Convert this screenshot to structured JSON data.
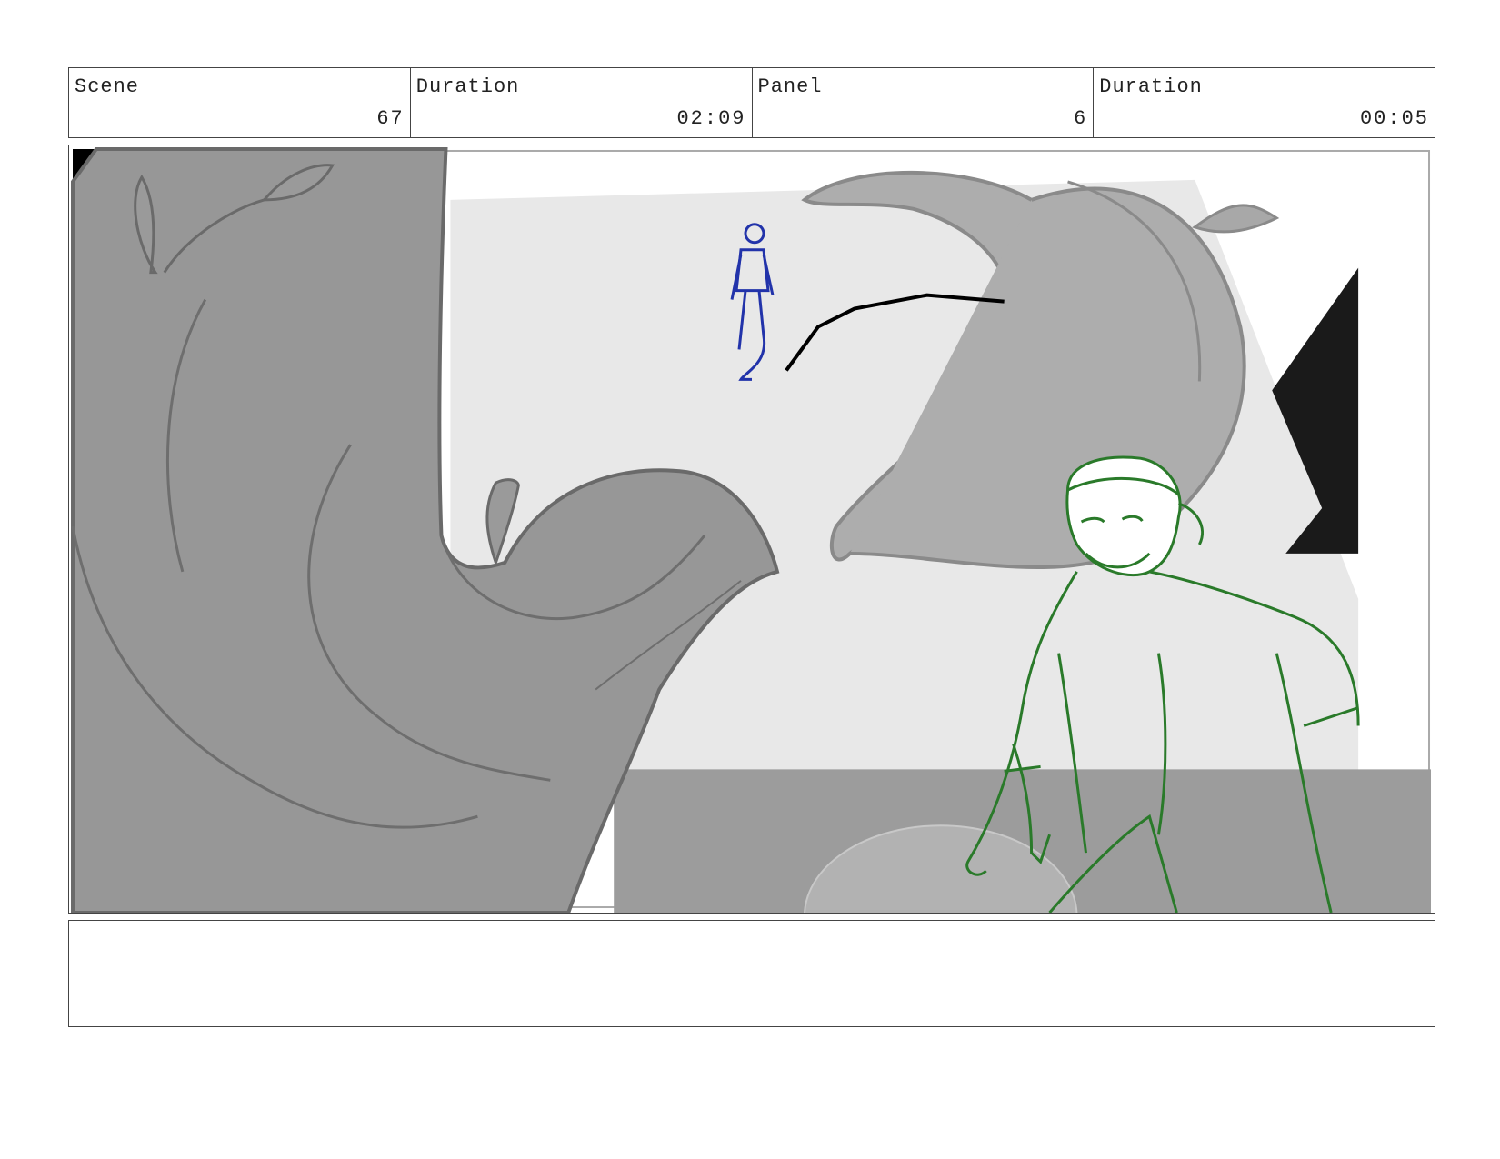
{
  "header": {
    "scene_label": "Scene",
    "scene_value": "67",
    "scene_duration_label": "Duration",
    "scene_duration_value": "02:09",
    "panel_label": "Panel",
    "panel_value": "6",
    "panel_duration_label": "Duration",
    "panel_duration_value": "00:05"
  },
  "notes": {
    "text": ""
  }
}
